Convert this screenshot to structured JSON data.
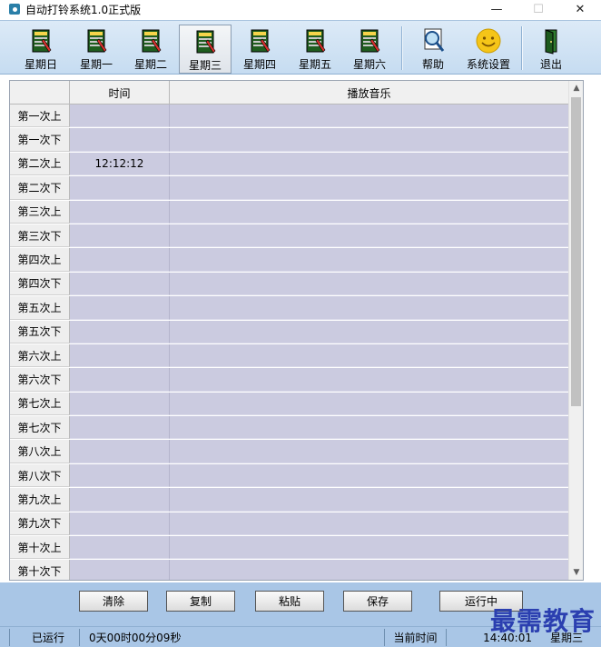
{
  "window": {
    "title": "自动打铃系统1.0正式版",
    "minimize_glyph": "—",
    "maximize_glyph": "☐",
    "close_glyph": "✕"
  },
  "toolbar": {
    "days": [
      {
        "label": "星期日",
        "active": false
      },
      {
        "label": "星期一",
        "active": false
      },
      {
        "label": "星期二",
        "active": false
      },
      {
        "label": "星期三",
        "active": true
      },
      {
        "label": "星期四",
        "active": false
      },
      {
        "label": "星期五",
        "active": false
      },
      {
        "label": "星期六",
        "active": false
      }
    ],
    "help_label": "帮助",
    "settings_label": "系统设置",
    "exit_label": "退出"
  },
  "grid": {
    "columns": [
      "",
      "时间",
      "播放音乐"
    ],
    "rows": [
      {
        "label": "第一次上",
        "time": "",
        "music": ""
      },
      {
        "label": "第一次下",
        "time": "",
        "music": ""
      },
      {
        "label": "第二次上",
        "time": "12:12:12",
        "music": ""
      },
      {
        "label": "第二次下",
        "time": "",
        "music": ""
      },
      {
        "label": "第三次上",
        "time": "",
        "music": ""
      },
      {
        "label": "第三次下",
        "time": "",
        "music": ""
      },
      {
        "label": "第四次上",
        "time": "",
        "music": ""
      },
      {
        "label": "第四次下",
        "time": "",
        "music": ""
      },
      {
        "label": "第五次上",
        "time": "",
        "music": ""
      },
      {
        "label": "第五次下",
        "time": "",
        "music": ""
      },
      {
        "label": "第六次上",
        "time": "",
        "music": ""
      },
      {
        "label": "第六次下",
        "time": "",
        "music": ""
      },
      {
        "label": "第七次上",
        "time": "",
        "music": ""
      },
      {
        "label": "第七次下",
        "time": "",
        "music": ""
      },
      {
        "label": "第八次上",
        "time": "",
        "music": ""
      },
      {
        "label": "第八次下",
        "time": "",
        "music": ""
      },
      {
        "label": "第九次上",
        "time": "",
        "music": ""
      },
      {
        "label": "第九次下",
        "time": "",
        "music": ""
      },
      {
        "label": "第十次上",
        "time": "",
        "music": ""
      },
      {
        "label": "第十次下",
        "time": "",
        "music": ""
      }
    ]
  },
  "actions": {
    "clear": "清除",
    "copy": "复制",
    "paste": "粘贴",
    "save": "保存",
    "running": "运行中"
  },
  "status": {
    "state": "已运行",
    "elapsed": "0天00时00分09秒",
    "current_time_label": "当前时间",
    "current_time": "14:40:01",
    "weekday": "星期三"
  },
  "watermark": "最需教育",
  "colors": {
    "toolbar_bg": "#c6dcf1",
    "cell_bg": "#cbcbe0",
    "panel_bg": "#a9c6e6",
    "watermark": "#2b3fb0"
  }
}
